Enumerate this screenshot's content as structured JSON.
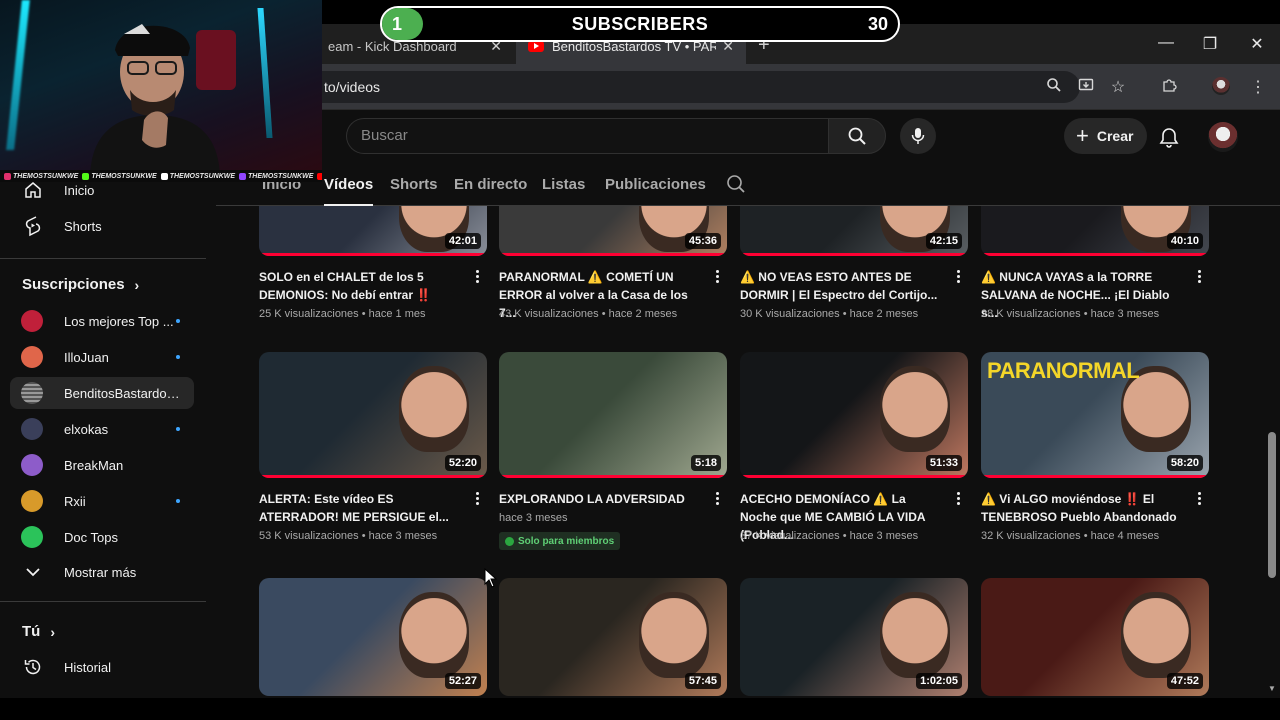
{
  "browser": {
    "tabs": [
      {
        "title": "eam - Kick Dashboard",
        "active": false
      },
      {
        "title": "BenditosBastardos TV • PARANORMAL",
        "active": true
      }
    ],
    "url": "to/videos"
  },
  "youtube": {
    "search_placeholder": "Buscar",
    "create_label": "Crear"
  },
  "channel_tabs": [
    "Inicio",
    "Vídeos",
    "Shorts",
    "En directo",
    "Listas",
    "Publicaciones"
  ],
  "active_tab": "Vídeos",
  "sidebar": {
    "nav": [
      {
        "label": "Inicio",
        "icon": "home-icon"
      },
      {
        "label": "Shorts",
        "icon": "shorts-icon"
      }
    ],
    "subscriptions_heading": "Suscripciones",
    "subscriptions": [
      {
        "label": "Los mejores Top ...",
        "new": true,
        "color": "#c0203a"
      },
      {
        "label": "IlloJuan",
        "new": true,
        "color": "#e0664a"
      },
      {
        "label": "BenditosBastardos ...",
        "new": false,
        "active": true,
        "color": "#7a7a7a"
      },
      {
        "label": "elxokas",
        "new": true,
        "color": "#3a3f5a"
      },
      {
        "label": "BreakMan",
        "new": false,
        "color": "#8d5cc9"
      },
      {
        "label": "Rxii",
        "new": true,
        "color": "#d89a2a"
      },
      {
        "label": "Doc Tops",
        "new": false,
        "color": "#2bc35a"
      }
    ],
    "show_more": "Mostrar más",
    "you_heading": "Tú",
    "history": "Historial"
  },
  "videos": [
    {
      "title": "SOLO en el CHALET de los 5 DEMONIOS: No debí entrar ‼️",
      "views": "25 K visualizaciones",
      "age": "hace 1 mes",
      "duration": "42:01",
      "palette": [
        "#2a3140",
        "#8a8f99"
      ]
    },
    {
      "title": "PARANORMAL ⚠️ COMETÍ UN ERROR al volver a la Casa de los 7...",
      "views": "43 K visualizaciones",
      "age": "hace 2 meses",
      "duration": "45:36",
      "palette": [
        "#3a3a3a",
        "#b08060"
      ]
    },
    {
      "title": "⚠️ NO VEAS ESTO ANTES DE DORMIR | El Espectro del Cortijo...",
      "views": "30 K visualizaciones",
      "age": "hace 2 meses",
      "duration": "42:15",
      "palette": [
        "#1e2225",
        "#5a5f63"
      ]
    },
    {
      "title": "⚠️ NUNCA VAYAS a la TORRE SALVANA de NOCHE... ¡El Diablo s...",
      "views": "28 K visualizaciones",
      "age": "hace 3 meses",
      "duration": "40:10",
      "palette": [
        "#1a1a1e",
        "#444850"
      ]
    },
    {
      "title": "ALERTA: Este vídeo ES ATERRADOR! ME PERSIGUE el...",
      "views": "53 K visualizaciones",
      "age": "hace 3 meses",
      "duration": "52:20",
      "palette": [
        "#1f2a33",
        "#6b5a4a"
      ]
    },
    {
      "title": "EXPLORANDO LA ADVERSIDAD",
      "views": "",
      "age": "hace 3 meses",
      "duration": "5:18",
      "members_only": "Solo para miembros",
      "palette": [
        "#3a4a3a",
        "#a0a890"
      ]
    },
    {
      "title": "ACECHO DEMONÍACO ⚠️ La Noche que ME CAMBIÓ LA VIDA (Poblad...",
      "views": "37 K visualizaciones",
      "age": "hace 3 meses",
      "duration": "51:33",
      "palette": [
        "#141618",
        "#c07860"
      ]
    },
    {
      "title": "⚠️ Vi ALGO moviéndose ‼️ El TENEBROSO Pueblo Abandonado",
      "views": "32 K visualizaciones",
      "age": "hace 4 meses",
      "duration": "58:20",
      "overlay_text": "PARANORMAL",
      "palette": [
        "#3a4a58",
        "#9aa4ae"
      ]
    },
    {
      "title": "",
      "views": "",
      "age": "",
      "duration": "52:27",
      "palette": [
        "#3a4a60",
        "#c08050"
      ]
    },
    {
      "title": "",
      "views": "",
      "age": "",
      "duration": "57:45",
      "palette": [
        "#2a2620",
        "#b07a5a"
      ]
    },
    {
      "title": "",
      "views": "",
      "age": "",
      "duration": "1:02:05",
      "palette": [
        "#1a2226",
        "#b08070"
      ]
    },
    {
      "title": "",
      "views": "",
      "age": "",
      "duration": "47:52",
      "palette": [
        "#4a1a16",
        "#b07a5a"
      ]
    }
  ],
  "overlay": {
    "subscribers_label": "SUBSCRIBERS",
    "current": "1",
    "goal": "30",
    "progress": 0.0333,
    "socials": [
      "THEMOSTSUNKWE",
      "THEMOSTSUNKWE",
      "THEMOSTSUNKWE",
      "THEMOSTSUNKWE",
      "THEMOSTSUNKWE",
      "THEMOSTSUNKWE"
    ]
  },
  "colors": {
    "background": "#0f0f0f",
    "accent_red": "#ff0033",
    "sub_green": "#4caf50",
    "link_blue": "#3ea6ff"
  }
}
